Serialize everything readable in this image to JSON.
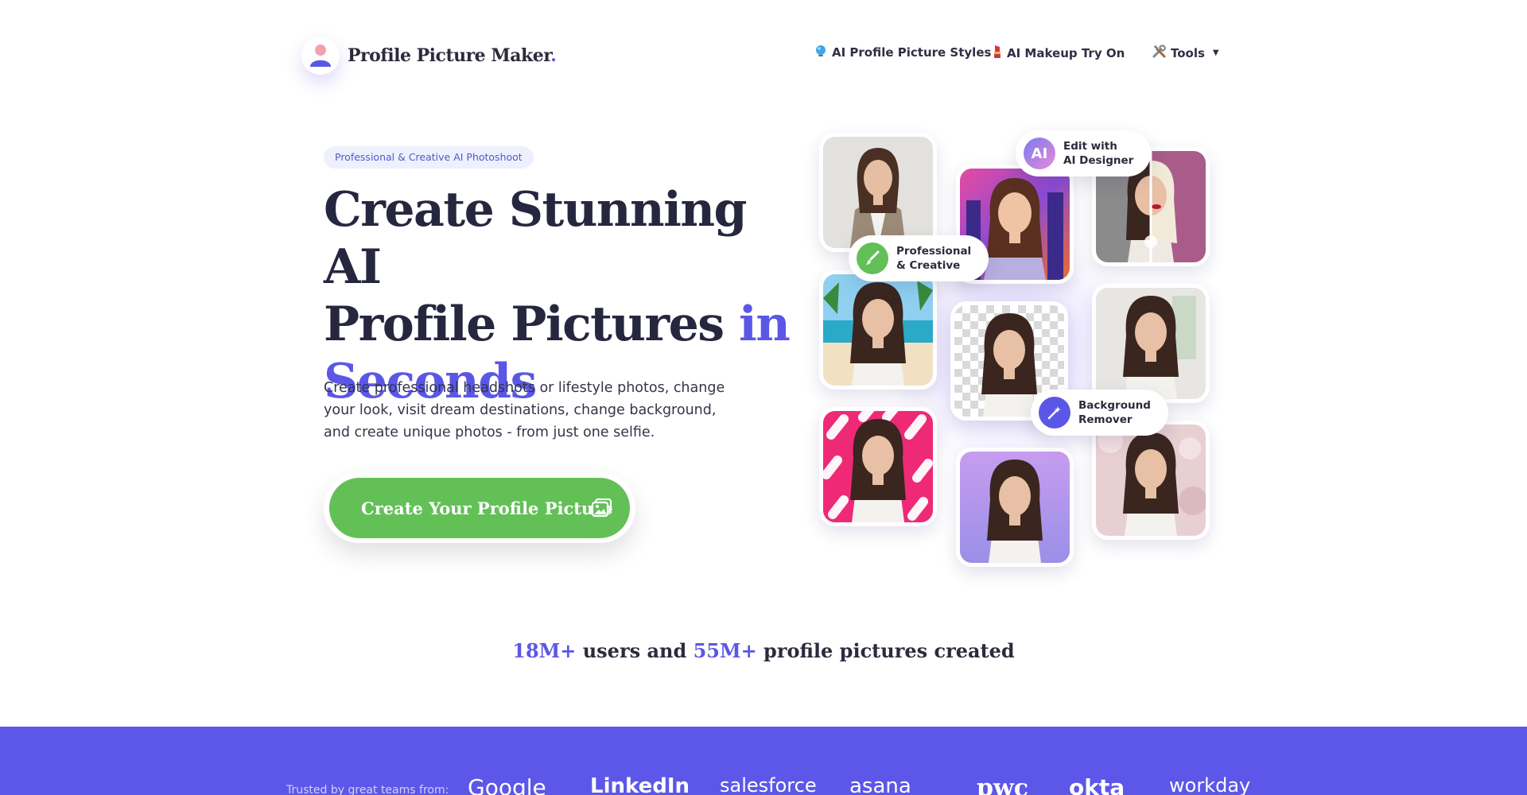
{
  "header": {
    "logo_text": "Profile Picture Maker",
    "logo_dot": ".",
    "nav": [
      {
        "icon": "globe-icon",
        "label": "AI Profile Picture Styles"
      },
      {
        "icon": "lipstick-icon",
        "label": "AI Makeup Try On"
      },
      {
        "icon": "tools-icon",
        "label": "Tools"
      }
    ]
  },
  "hero": {
    "pill": "Professional & Creative AI Photoshoot",
    "headline_line1": "Create Stunning AI",
    "headline_line2": "Profile Pictures",
    "headline_accent_in": "in",
    "headline_accent_seconds": "Seconds",
    "subtitle": "Create professional headshots or lifestyle photos, change your look, visit dream destinations, change background, and create unique photos - from just one selfie.",
    "cta_label": "Create Your Profile Picture"
  },
  "features": {
    "ai_designer": {
      "badge": "AI",
      "line1": "Edit with",
      "line2": "AI Designer"
    },
    "professional": {
      "line1": "Professional",
      "line2": "& Creative"
    },
    "background": {
      "line1": "Background",
      "line2": "Remover"
    }
  },
  "stats": {
    "users_count": "18M+",
    "users_text": "users and",
    "pictures_count": "55M+",
    "pictures_text": "profile pictures created"
  },
  "trust": {
    "label": "Trusted by great teams from:",
    "brands": [
      "Google",
      "LinkedIn",
      "salesforce",
      "asana",
      "pwc",
      "okta",
      "workday"
    ]
  },
  "colors": {
    "accent": "#5b57e6",
    "cta_green": "#63c057",
    "band": "#5c57e8"
  }
}
